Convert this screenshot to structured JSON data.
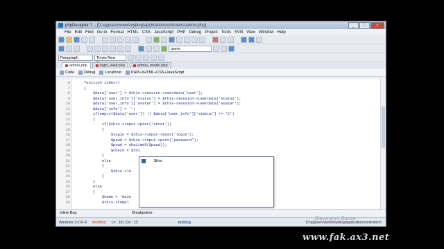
{
  "window": {
    "title": "phpDesigner 7",
    "path": "- [D:\\appserv\\www\\myblog\\application\\controllers\\admin.php]"
  },
  "menu": [
    "File",
    "Edit",
    "Find",
    "Go to",
    "Format",
    "HTML",
    "CSS",
    "JavaScript",
    "PHP",
    "Debug",
    "Project",
    "Tools",
    "SVN",
    "View",
    "Window",
    "Help"
  ],
  "toolbar": {
    "style_select": "Paragraph",
    "font_select": "Times New Rom",
    "table_select": "users"
  },
  "file_tabs": [
    "admin.php",
    "login_view.php",
    "admin_model.php"
  ],
  "view_bar": {
    "code": "Code",
    "debug": "Debug",
    "host": "Localhost",
    "syntax": "PHP+XHTML+CSS+JavaScript"
  },
  "code_lines": [
    {
      "n": "6",
      "text": "function index()"
    },
    {
      "n": "7",
      "text": "{"
    },
    {
      "n": "8",
      "text": "    $data['user'] = $this->session->userdata('user');"
    },
    {
      "n": "9",
      "text": "    $data['user_info']['status'] = $this->session->userdata('status');"
    },
    {
      "n": "10",
      "text": "    $data['user_info']['avatar'] = $this->session->userdata('avatar');"
    },
    {
      "n": "11",
      "text": "    $data['info'] = '';"
    },
    {
      "n": "12",
      "text": "    if(empty($data['user']) || $data['user_info']['status'] != '2')"
    },
    {
      "n": "13",
      "text": "    {"
    },
    {
      "n": "14",
      "text": "        if($this->input->post('enter'))"
    },
    {
      "n": "15",
      "text": "        {"
    },
    {
      "n": "16",
      "text": "            $login = $this->input->post('login');"
    },
    {
      "n": "17",
      "text": "            $pswd = $this->input->post('password');"
    },
    {
      "n": "18",
      "text": "            $pswd = sha1(md5($pswd));"
    },
    {
      "n": "19",
      "text": "            $check = $thi"
    },
    {
      "n": "20",
      "text": "        }"
    },
    {
      "n": "21",
      "text": "        else"
    },
    {
      "n": "22",
      "text": "        {"
    },
    {
      "n": "23",
      "text": "            $this->lo"
    },
    {
      "n": "24",
      "text": "        }"
    },
    {
      "n": "25",
      "text": "    }"
    },
    {
      "n": "26",
      "text": "    else"
    },
    {
      "n": "27",
      "text": "    {"
    },
    {
      "n": "28",
      "text": "        $name = 'main"
    },
    {
      "n": "29",
      "text": "        $this->templ"
    }
  ],
  "autocomplete": {
    "items": [
      "$this"
    ]
  },
  "bottom_panel": {
    "left": "Inline Bug",
    "right": "Breakpoints"
  },
  "status": {
    "encoding": "Windows | UTF-8",
    "modified": "Modified",
    "position": "Ln : 18 | Col : 23",
    "project": "myblog",
    "path": "D:\\appserv\\www\\myblog\\application\\controllers\\"
  },
  "signature": "Дмитрий Ваган",
  "watermark": "www.fak.ax3.net"
}
